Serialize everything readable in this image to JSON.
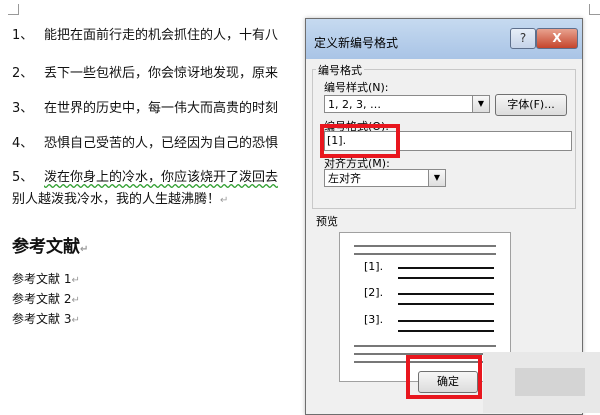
{
  "document": {
    "list_items": [
      {
        "num": "1、",
        "text": "能把在面前行走的机会抓住的人，十有八"
      },
      {
        "num": "2、",
        "text": "丢下一些包袱后，你会惊讶地发现，原来"
      },
      {
        "num": "3、",
        "text": "在世界的历史中，每一伟大而高贵的时刻"
      },
      {
        "num": "4、",
        "text": "恐惧自己受苦的人，已经因为自己的恐惧"
      },
      {
        "num": "5、",
        "text": "泼在你身上的冷水，你应该烧开了泼回去"
      }
    ],
    "item5_continuation": "别人越泼我冷水，我的人生越沸腾！",
    "heading": "参考文献",
    "references": [
      "参考文献 1",
      "参考文献 2",
      "参考文献 3"
    ],
    "paragraph_mark": "↵"
  },
  "dialog": {
    "title": "定义新编号格式",
    "help_label": "?",
    "close_label": "X",
    "group_label": "编号格式",
    "style_label": "编号样式(N):",
    "style_value": "1, 2, 3, …",
    "font_button": "字体(F)...",
    "format_label": "编号格式(O):",
    "format_value": "[1].",
    "align_label": "对齐方式(M):",
    "align_value": "左对齐",
    "preview_label": "预览",
    "preview_items": [
      "[1].",
      "[2].",
      "[3]."
    ],
    "ok_button": "确定"
  },
  "colors": {
    "highlight": "#e8161e",
    "titlebar": "#a9c4e6",
    "spell_underline": "#2f9e2f"
  }
}
